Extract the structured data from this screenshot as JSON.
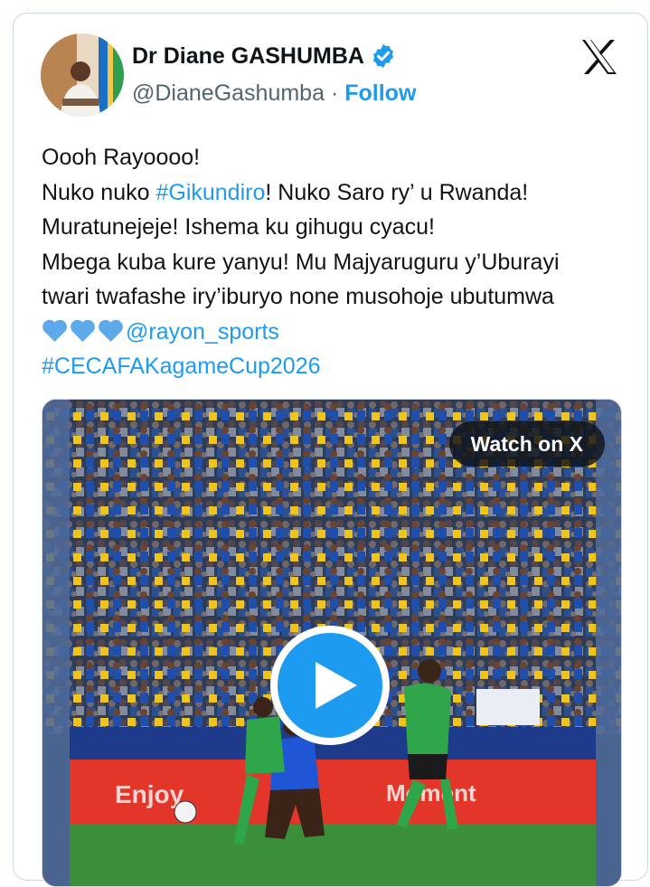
{
  "author": {
    "name": "Dr Diane GASHUMBA",
    "handle": "@DianeGashumba",
    "separator": "·",
    "follow_label": "Follow",
    "verified": true
  },
  "tweet": {
    "line1": "Oooh Rayoooo!",
    "line2_before": "Nuko nuko ",
    "line2_hashtag": "#Gikundiro",
    "line2_after": "! Nuko Saro ry’ u Rwanda!",
    "line3": "Muratunejeje! Ishema ku gihugu cyacu!",
    "line4": "Mbega kuba kure yanyu! Mu Majyaruguru y’Uburayi",
    "line5": "twari twafashe iry’iburyo none musohoje ubutumwa",
    "mention": "@rayon_sports",
    "hashtag2": "#CECAFAKagameCup2026"
  },
  "media": {
    "watch_label": "Watch on X",
    "banner_left": "Enjoy",
    "banner_mid": "Moment"
  },
  "colors": {
    "link": "#1d9bf0",
    "text": "#0f1419",
    "secondary": "#536471",
    "heart": "#5da9e9"
  },
  "icons": {
    "verified": "verified-badge-icon",
    "brand": "x-logo-icon",
    "play": "play-icon",
    "heart": "light-blue-heart-icon"
  }
}
